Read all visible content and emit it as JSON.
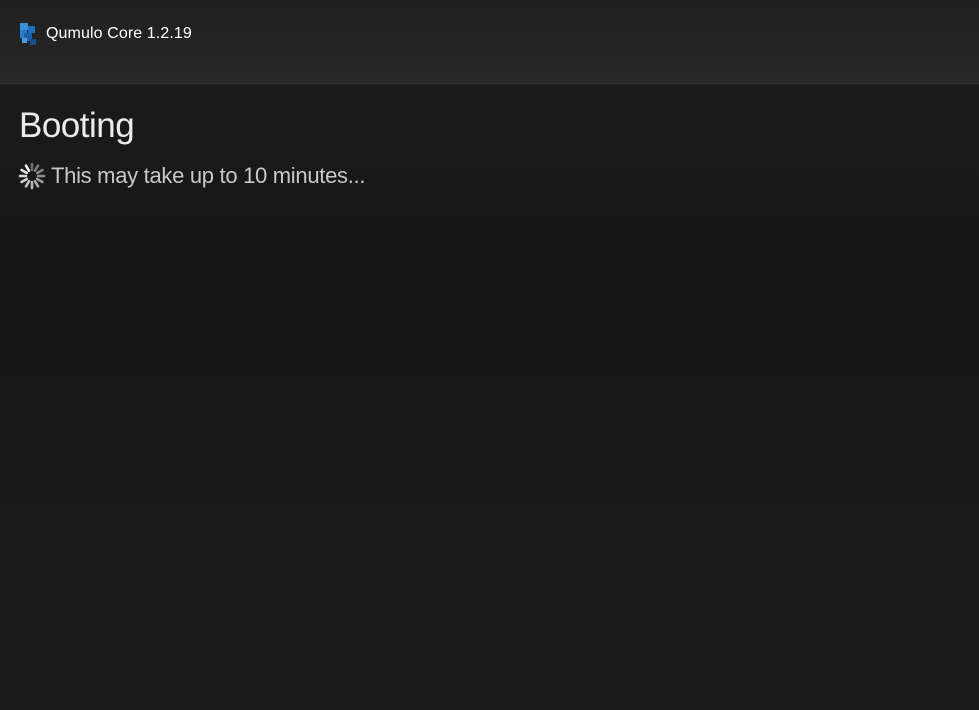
{
  "app": {
    "name": "Qumulo Core",
    "version": "1.2.19",
    "brand_label": "Qumulo Core 1.2.19",
    "logo_icon": "qumulo-logo-icon",
    "accent_color": "#2f86d3"
  },
  "main": {
    "title": "Booting",
    "status_icon": "loading-spinner-icon",
    "status_message": "This may take up to 10 minutes..."
  }
}
